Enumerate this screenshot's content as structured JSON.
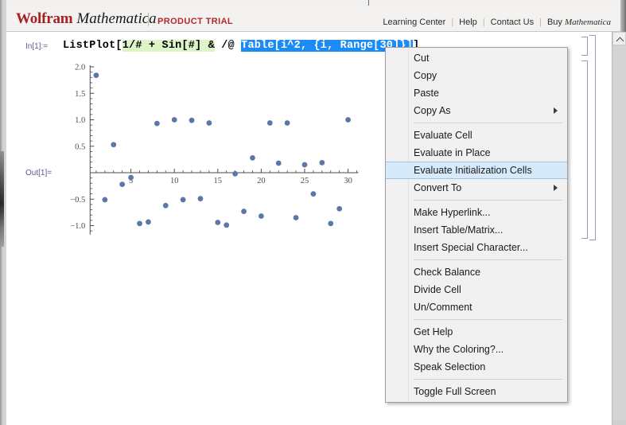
{
  "window": {
    "app_title": "Wolfram Mathematica",
    "brand_word_1": "Wolfram",
    "brand_word_2": "Mathematica",
    "product_badge": "PRODUCT TRIAL",
    "brand_color": "#a81f23",
    "badge_color": "#b3272d"
  },
  "topnav": {
    "items": [
      {
        "label": "Learning Center"
      },
      {
        "label": "Help"
      },
      {
        "label": "Contact Us"
      },
      {
        "label": "Buy ",
        "emphasis": "Mathematica"
      }
    ],
    "separator": "|"
  },
  "notebook": {
    "input_cell": {
      "label": "In[1]:=",
      "code_plain": "ListPlot[1/# + Sin[#] & /@ Table[i^2, {i, Range[30]}]]",
      "segments": {
        "prefix": "ListPlot[",
        "highlighted_green": "1/# + Sin[#] &",
        "middle": " /@ ",
        "selected_blue": "Table[i^2, {i, Range[30]}]",
        "suffix": "]"
      },
      "selection_color": "#1c8bf5",
      "highlight_color": "#ddf3c8"
    },
    "output_cell": {
      "label": "Out[1]="
    }
  },
  "chart_data": {
    "type": "scatter",
    "title": "",
    "xlabel": "",
    "ylabel": "",
    "xlim": [
      0,
      31
    ],
    "ylim": [
      -1.15,
      2.05
    ],
    "grid": false,
    "legend": null,
    "point_color": "#5b77a8",
    "expression": "1/# + Sin[#] & /@ Table[i^2, {i, Range[30]}]",
    "xticks": [
      5,
      10,
      15,
      20,
      25,
      30
    ],
    "xticklabels": [
      "5",
      "10",
      "15",
      "20",
      "25",
      "30"
    ],
    "yticks": [
      -1.0,
      -0.5,
      0,
      0.5,
      1.0,
      1.5,
      2.0
    ],
    "yticklabels": [
      "-1.0",
      "-0.5",
      "",
      "0.5",
      "1.0",
      "1.5",
      "2.0"
    ],
    "x": [
      1,
      2,
      3,
      4,
      5,
      6,
      7,
      8,
      9,
      10,
      11,
      12,
      13,
      14,
      15,
      16,
      17,
      18,
      19,
      20,
      21,
      22,
      23,
      24,
      25,
      26,
      27,
      28,
      29,
      30
    ],
    "y": [
      1.84,
      -0.51,
      0.53,
      -0.22,
      -0.09,
      -0.96,
      -0.93,
      0.93,
      -0.62,
      1.0,
      -0.51,
      0.99,
      -0.49,
      0.94,
      -0.94,
      -0.99,
      -0.02,
      -0.73,
      0.28,
      -0.82,
      0.94,
      0.18,
      0.94,
      -0.85,
      0.15,
      -0.4,
      0.19,
      -0.96,
      -0.68,
      1.0
    ],
    "point_count": 30
  },
  "context_menu": {
    "highlight_color": "#d7eafb",
    "groups": [
      {
        "items": [
          {
            "label": "Cut",
            "submenu": false
          },
          {
            "label": "Copy",
            "submenu": false
          },
          {
            "label": "Paste",
            "submenu": false
          },
          {
            "label": "Copy As",
            "submenu": true
          }
        ]
      },
      {
        "items": [
          {
            "label": "Evaluate Cell",
            "submenu": false
          },
          {
            "label": "Evaluate in Place",
            "submenu": false
          },
          {
            "label": "Evaluate Initialization Cells",
            "submenu": false,
            "highlighted": true
          },
          {
            "label": "Convert To",
            "submenu": true
          }
        ]
      },
      {
        "items": [
          {
            "label": "Make Hyperlink...",
            "submenu": false
          },
          {
            "label": "Insert Table/Matrix...",
            "submenu": false
          },
          {
            "label": "Insert Special Character...",
            "submenu": false
          }
        ]
      },
      {
        "items": [
          {
            "label": "Check Balance",
            "submenu": false
          },
          {
            "label": "Divide Cell",
            "submenu": false
          },
          {
            "label": "Un/Comment",
            "submenu": false
          }
        ]
      },
      {
        "items": [
          {
            "label": "Get Help",
            "submenu": false
          },
          {
            "label": "Why the Coloring?...",
            "submenu": false
          },
          {
            "label": "Speak Selection",
            "submenu": false
          }
        ]
      },
      {
        "items": [
          {
            "label": "Toggle Full Screen",
            "submenu": false
          }
        ]
      }
    ]
  }
}
